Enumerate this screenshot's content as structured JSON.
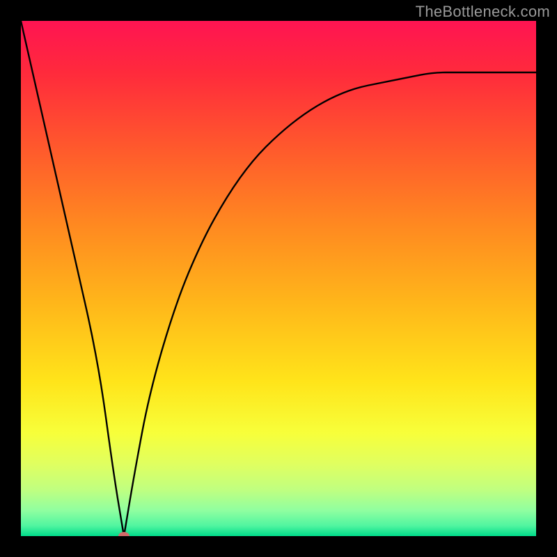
{
  "watermark": "TheBottleneck.com",
  "chart_data": {
    "type": "line",
    "title": "",
    "xlabel": "",
    "ylabel": "",
    "xlim": [
      0,
      100
    ],
    "ylim": [
      0,
      100
    ],
    "grid": false,
    "legend": false,
    "series": [
      {
        "name": "bottleneck-curve",
        "x": [
          0,
          5,
          10,
          15,
          18,
          20,
          22,
          25,
          30,
          35,
          40,
          45,
          50,
          55,
          60,
          65,
          70,
          75,
          80,
          85,
          90,
          95,
          100
        ],
        "values": [
          100,
          78,
          56,
          34,
          12,
          0,
          12,
          28,
          45,
          57,
          66,
          73,
          78,
          82,
          85,
          87,
          88,
          89,
          90,
          90,
          90,
          90,
          90
        ]
      }
    ],
    "marker": {
      "x": 20,
      "y": 0,
      "color": "#d36a6a"
    }
  },
  "colors": {
    "background_frame": "#000000",
    "curve": "#000000",
    "marker": "#d36a6a",
    "gradient_top": "#ff1452",
    "gradient_bottom": "#00db8a"
  }
}
